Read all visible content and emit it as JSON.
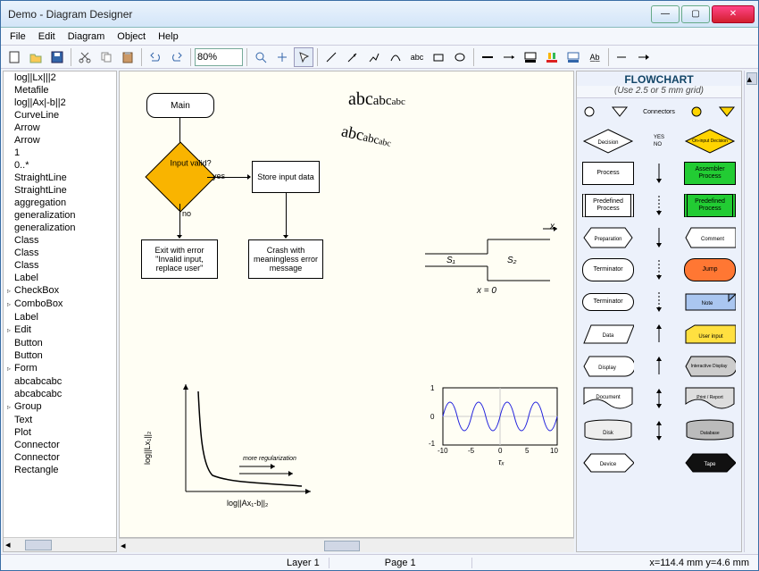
{
  "window": {
    "title": "Demo - Diagram Designer"
  },
  "menu": {
    "file": "File",
    "edit": "Edit",
    "diagram": "Diagram",
    "object": "Object",
    "help": "Help"
  },
  "toolbar": {
    "zoom": "80%"
  },
  "tree": {
    "items": [
      {
        "label": "log||Lx|||2",
        "chevron": false
      },
      {
        "label": "Metafile",
        "chevron": false
      },
      {
        "label": "log||Ax|-b||2",
        "chevron": false
      },
      {
        "label": "CurveLine",
        "chevron": false
      },
      {
        "label": "Arrow",
        "chevron": false
      },
      {
        "label": "Arrow",
        "chevron": false
      },
      {
        "label": "1",
        "chevron": false
      },
      {
        "label": "0..*",
        "chevron": false
      },
      {
        "label": "StraightLine",
        "chevron": false
      },
      {
        "label": "StraightLine",
        "chevron": false
      },
      {
        "label": "aggregation",
        "chevron": false
      },
      {
        "label": "generalization",
        "chevron": false
      },
      {
        "label": "generalization",
        "chevron": false
      },
      {
        "label": "Class",
        "chevron": false
      },
      {
        "label": "Class",
        "chevron": false
      },
      {
        "label": "Class",
        "chevron": false
      },
      {
        "label": "Label",
        "chevron": false
      },
      {
        "label": "CheckBox",
        "chevron": true
      },
      {
        "label": "ComboBox",
        "chevron": true
      },
      {
        "label": "Label",
        "chevron": false
      },
      {
        "label": "Edit",
        "chevron": true
      },
      {
        "label": "Button",
        "chevron": false
      },
      {
        "label": "Button",
        "chevron": false
      },
      {
        "label": "Form",
        "chevron": true
      },
      {
        "label": "abcabcabc",
        "chevron": false
      },
      {
        "label": "abcabcabc",
        "chevron": false
      },
      {
        "label": "Group",
        "chevron": true
      },
      {
        "label": "Text",
        "chevron": false
      },
      {
        "label": "Plot",
        "chevron": false
      },
      {
        "label": "Connector",
        "chevron": false
      },
      {
        "label": "Connector",
        "chevron": false
      },
      {
        "label": "Rectangle",
        "chevron": false
      }
    ]
  },
  "palette": {
    "title": "FLOWCHART",
    "subtitle": "(Use 2.5 or 5 mm grid)",
    "connectors_label": "Connectors",
    "decision": "Decision",
    "decision_yes": "YES",
    "decision_no": "NO",
    "oninput": "On-input Decision",
    "process": "Process",
    "asm_process": "Assembler Process",
    "predef_process": "Predefined Process",
    "predef_process2": "Predefined Process",
    "preparation": "Preparation",
    "comment": "Comment",
    "terminator1": "Terminator",
    "jump": "Jump",
    "terminator2": "Terminator",
    "note": "Note",
    "data": "Data",
    "user_input": "User input",
    "display": "Display",
    "interactive": "Interactive Display",
    "document": "Document",
    "print": "Print / Report",
    "disk": "Disk",
    "database": "Database",
    "device": "Device",
    "tape": "Tape"
  },
  "canvas": {
    "main": "Main",
    "input_valid": "Input valid?",
    "yes": "yes",
    "no": "no",
    "store": "Store input data",
    "exit_err": "Exit with error \"Invalid input, replace user\"",
    "crash": "Crash with meaningless error message",
    "abc1": "abcabcabc",
    "abc2": "abcabcabc",
    "s1": "S₁",
    "s2": "S₂",
    "x": "x",
    "xeq0": "x = 0",
    "loglx": "log||Lx₁||₂",
    "logax": "log||Ax₁-b||₂",
    "morereg": "more regularization",
    "wave_ticks_y": [
      "1",
      "0",
      "-1"
    ],
    "wave_ticks_x": [
      "-10",
      "-5",
      "0",
      "5",
      "10"
    ],
    "wave_xlabel": "τₓ"
  },
  "status": {
    "layer": "Layer 1",
    "page": "Page 1",
    "coords": "x=114.4 mm   y=4.6 mm"
  }
}
